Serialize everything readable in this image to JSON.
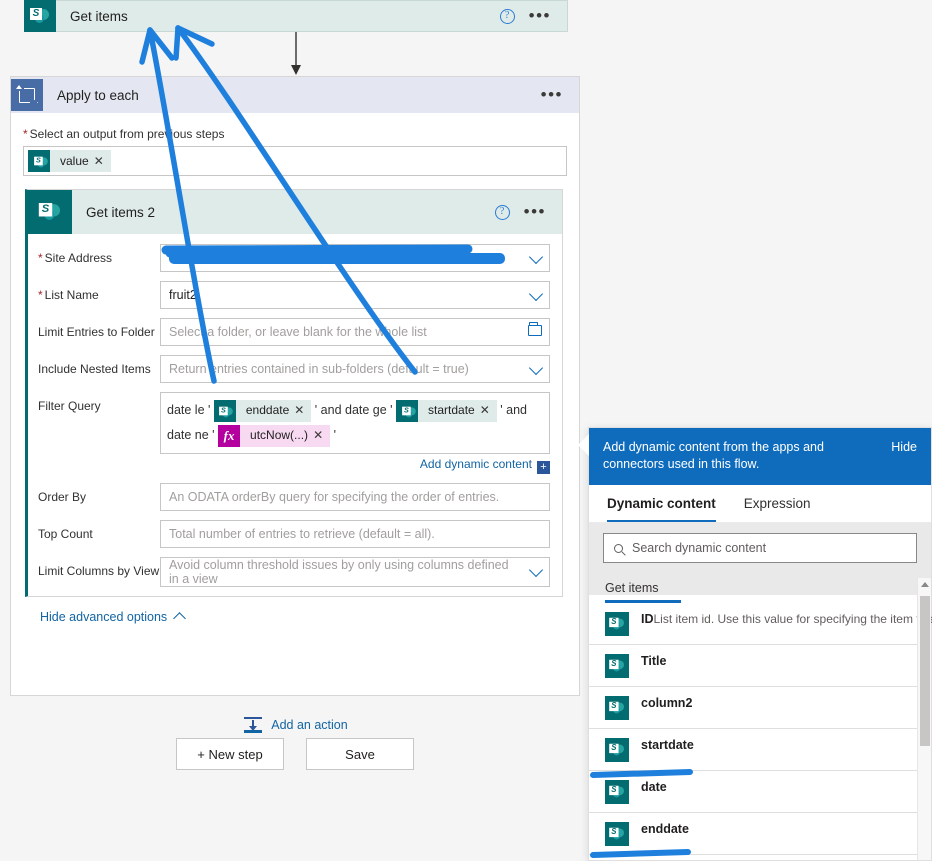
{
  "top_action": {
    "title": "Get items",
    "icon": "sharepoint-icon",
    "help": "?",
    "menu": "•••"
  },
  "apply_to_each": {
    "title": "Apply to each",
    "icon": "loop-icon",
    "menu": "•••",
    "output_label": "Select an output from previous steps",
    "required_star": "*",
    "output_token": "value",
    "token_remove": "✕"
  },
  "get_items_2": {
    "title": "Get items 2",
    "icon": "sharepoint-icon",
    "help": "?",
    "menu": "•••",
    "fields": {
      "site_address": {
        "label": "Site Address",
        "required": true,
        "value": "",
        "redacted": true
      },
      "list_name": {
        "label": "List Name",
        "required": true,
        "value": "fruit2"
      },
      "limit_entries_to_folder": {
        "label": "Limit Entries to Folder",
        "required": false,
        "placeholder": "Select a folder, or leave blank for the whole list"
      },
      "include_nested_items": {
        "label": "Include Nested Items",
        "required": false,
        "placeholder": "Return entries contained in sub-folders (default = true)"
      },
      "filter_query": {
        "label": "Filter Query",
        "required": false,
        "parts": [
          {
            "type": "text",
            "value": "date le '"
          },
          {
            "type": "token",
            "value": "enddate",
            "source": "sharepoint"
          },
          {
            "type": "text",
            "value": "' and date ge '"
          },
          {
            "type": "token",
            "value": "startdate",
            "source": "sharepoint"
          },
          {
            "type": "text",
            "value": "' and date ne '"
          },
          {
            "type": "expression",
            "value": "utcNow(...)"
          },
          {
            "type": "text",
            "value": "'"
          }
        ]
      },
      "order_by": {
        "label": "Order By",
        "required": false,
        "placeholder": "An ODATA orderBy query for specifying the order of entries."
      },
      "top_count": {
        "label": "Top Count",
        "required": false,
        "placeholder": "Total number of entries to retrieve (default = all)."
      },
      "limit_columns_by_view": {
        "label": "Limit Columns by View",
        "required": false,
        "placeholder": "Avoid column threshold issues by only using columns defined in a view"
      }
    },
    "add_dynamic_content": "Add dynamic content",
    "add_dynamic_plus": "+",
    "hide_advanced_options": "Hide advanced options"
  },
  "add_action": {
    "label": "Add an action",
    "icon": "insert-action-icon"
  },
  "footer": {
    "new_step": "+ New step",
    "save": "Save"
  },
  "dynamic_panel": {
    "header_text": "Add dynamic content from the apps and connectors used in this flow.",
    "hide_label": "Hide",
    "tabs": [
      {
        "label": "Dynamic content",
        "active": true
      },
      {
        "label": "Expression",
        "active": false
      }
    ],
    "search_placeholder": "Search dynamic content",
    "search_value": "",
    "group": "Get items",
    "items": [
      {
        "name": "ID",
        "desc": "List item id. Use this value for specifying the item to act o..."
      },
      {
        "name": "Title",
        "desc": ""
      },
      {
        "name": "column2",
        "desc": ""
      },
      {
        "name": "startdate",
        "desc": ""
      },
      {
        "name": "date",
        "desc": ""
      },
      {
        "name": "enddate",
        "desc": ""
      }
    ]
  },
  "colors": {
    "sharepoint_teal": "#036c70",
    "loop_blue": "#486ca5",
    "accent_blue": "#0f6cbd",
    "expression_magenta": "#b4009e",
    "annotation_blue": "#1f7fdc",
    "card_header_mint": "#dfebe9",
    "apply_header": "#e4e7f1"
  }
}
